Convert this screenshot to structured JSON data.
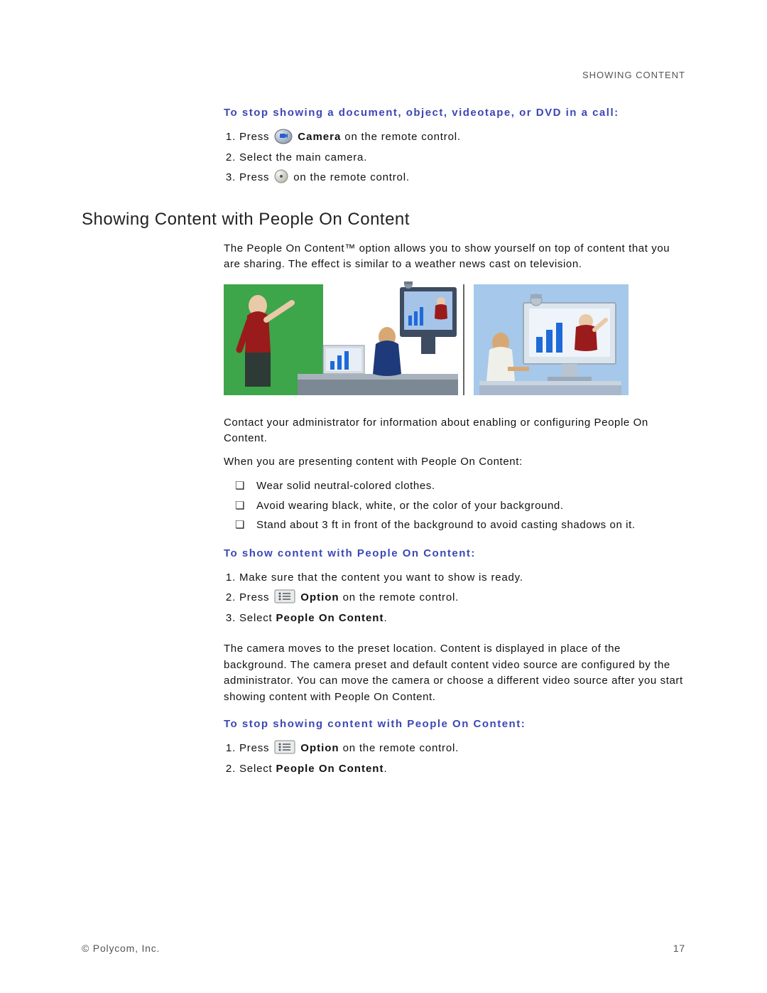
{
  "header": {
    "label": "SHOWING CONTENT"
  },
  "section1": {
    "heading": "To stop showing a document, object, videotape, or DVD in a call:",
    "steps": {
      "s1a": "Press ",
      "s1b": " Camera on the remote control.",
      "s1boldCamera": "Camera",
      "s2": "Select the main camera.",
      "s3a": "Press ",
      "s3b": " on the remote control."
    }
  },
  "section2": {
    "title": "Showing Content with People On Content",
    "intro": "The People On Content™ option allows you to show yourself on top of content that you are sharing. The effect is similar to a weather news cast on television.",
    "contact": "Contact your administrator for information about enabling or configuring People On Content.",
    "whenPresenting": "When you are presenting content with People On Content:",
    "tips": [
      "Wear solid neutral-colored clothes.",
      "Avoid wearing black, white, or the color of your background.",
      "Stand about 3 ft in front of the background to avoid casting shadows on it."
    ]
  },
  "section3": {
    "heading": "To show content with People On Content:",
    "steps": {
      "s1": "Make sure that the content you want to show is ready.",
      "s2a": "Press ",
      "s2b": "Option",
      "s2c": " on the remote control.",
      "s3a": "Select ",
      "s3b": "People On Content",
      "s3c": "."
    },
    "note": "The camera moves to the preset location. Content is displayed in place of the background. The camera preset and default content video source are configured by the administrator. You can move the camera or choose a different video source after you start showing content with People On Content."
  },
  "section4": {
    "heading": "To stop showing content with People On Content:",
    "steps": {
      "s1a": "Press ",
      "s1b": "Option",
      "s1c": " on the remote control.",
      "s2a": "Select ",
      "s2b": "People On Content",
      "s2c": "."
    }
  },
  "footer": {
    "left": "© Polycom, Inc.",
    "right": "17"
  }
}
